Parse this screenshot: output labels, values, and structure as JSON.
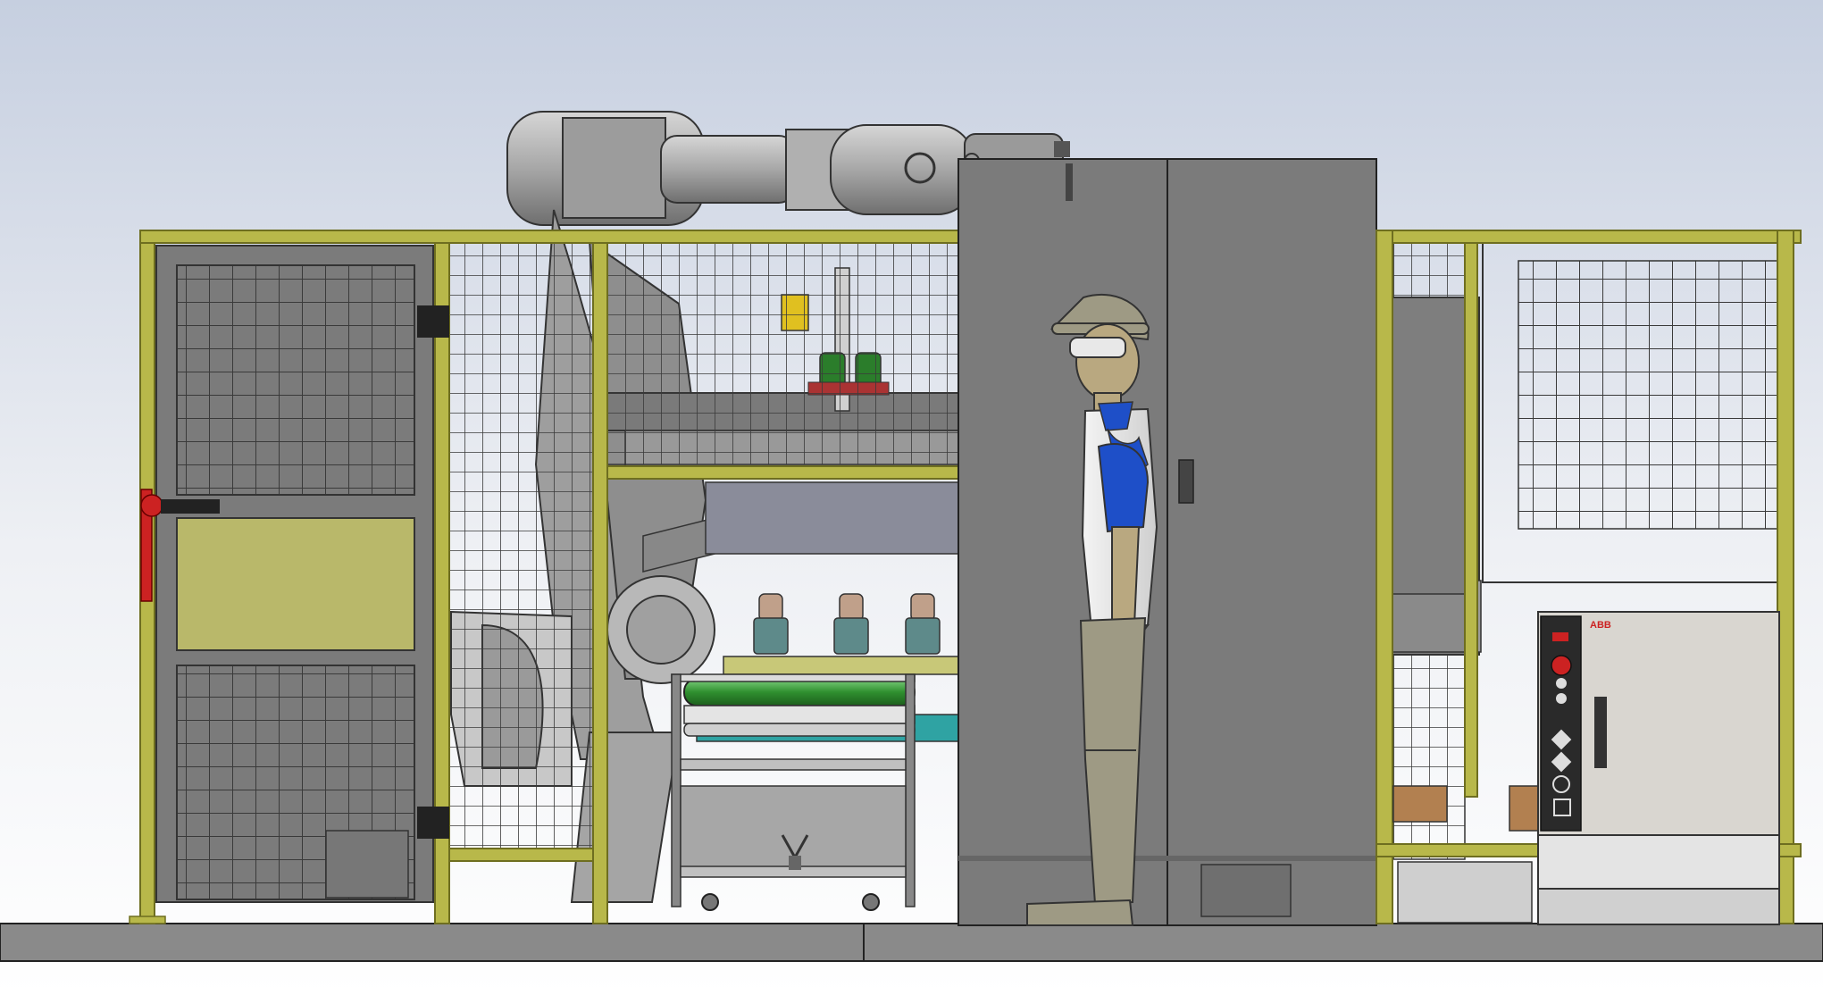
{
  "scene": {
    "controller_brand": "ABB",
    "colors": {
      "background_top": "#c6cfe0",
      "background_bottom": "#ffffff",
      "fence_frame": "#b8b84a",
      "fence_frame_dark": "#6e6e20",
      "mesh": "#3a3a3a",
      "door_panel": "#b9b86a",
      "robot_body": "#a9a9a9",
      "cabinet": "#7b7b7b",
      "conveyor_belt": "#3f9a3f",
      "teal_base": "#2fa3a3",
      "shirt_blue": "#1e4fc8",
      "skin_tan": "#b9a880",
      "trousers": "#9e9a84",
      "hinge_red": "#cc2222",
      "controller_body": "#d9d6d0",
      "floor": "#7a7a7a",
      "floor_line": "#222222"
    }
  }
}
